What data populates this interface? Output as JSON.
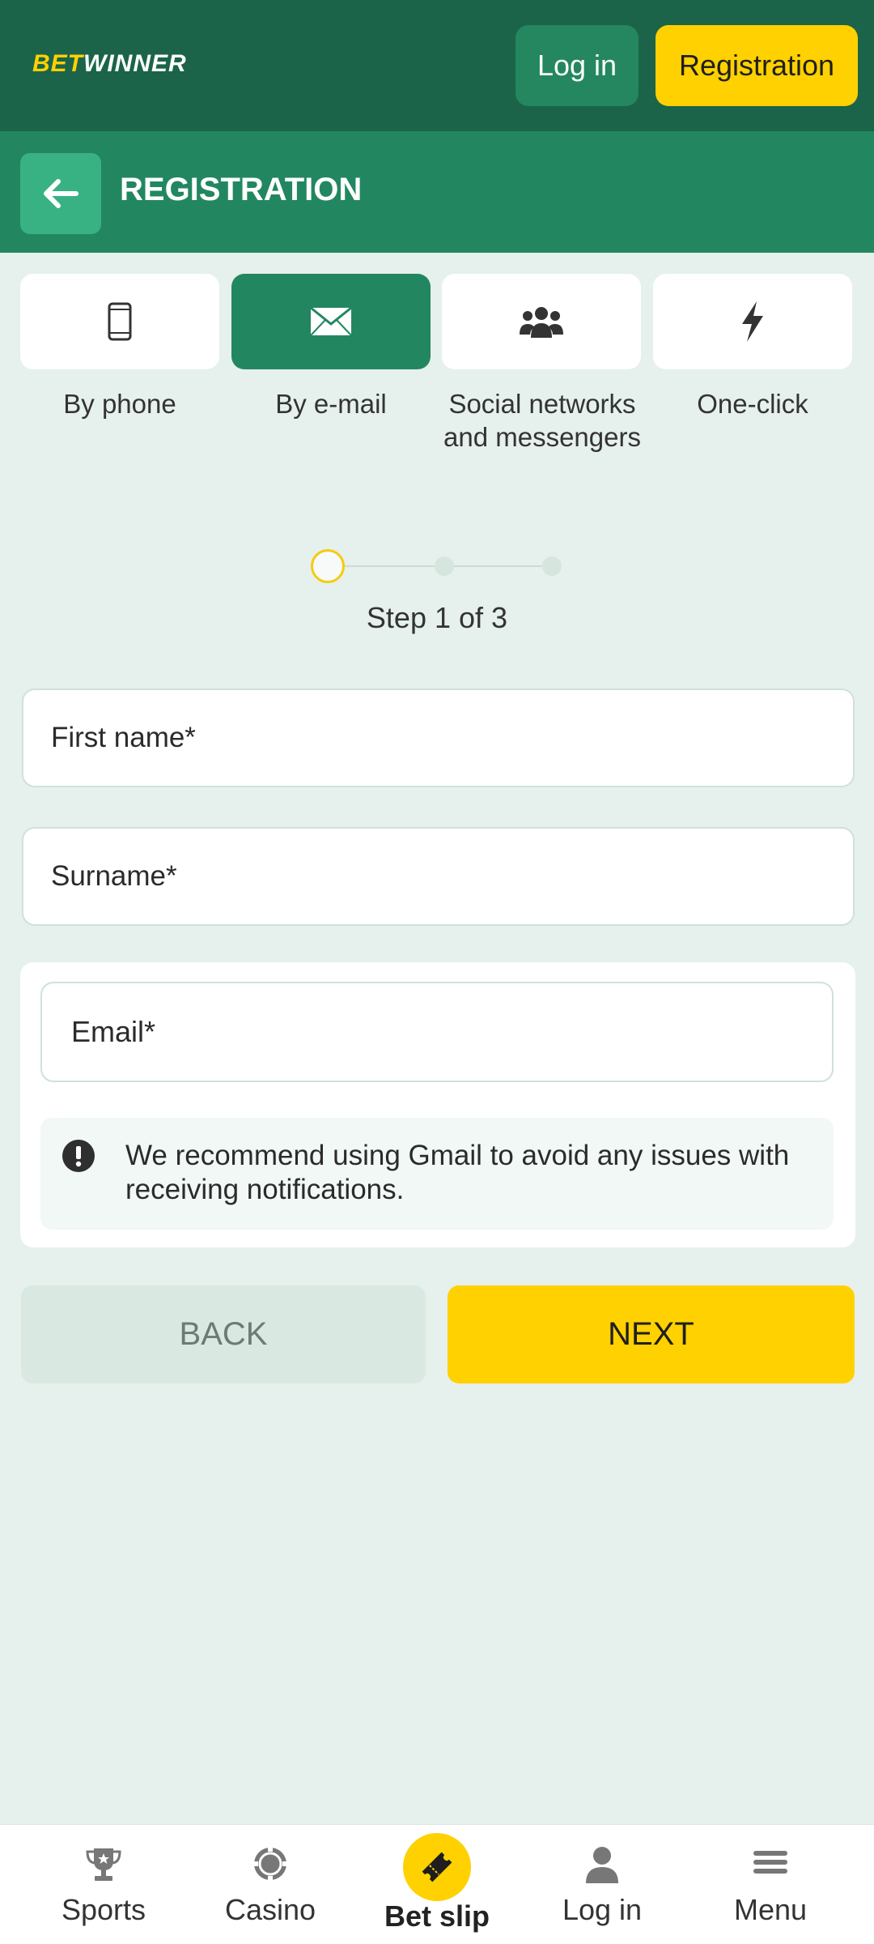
{
  "header": {
    "logo_bet": "BET",
    "logo_winner": "WINNER",
    "login_label": "Log in",
    "registration_label": "Registration"
  },
  "page": {
    "title": "REGISTRATION"
  },
  "methods": [
    {
      "label": "By phone",
      "icon": "phone-icon",
      "active": false
    },
    {
      "label": "By e-mail",
      "icon": "envelope-icon",
      "active": true
    },
    {
      "label": "Social networks and messengers",
      "icon": "users-icon",
      "active": false
    },
    {
      "label": "One-click",
      "icon": "lightning-icon",
      "active": false
    }
  ],
  "stepper": {
    "current": 1,
    "total": 3,
    "text": "Step 1 of 3"
  },
  "form": {
    "first_name_placeholder": "First name*",
    "surname_placeholder": "Surname*",
    "email_placeholder": "Email*",
    "notice": "We recommend using Gmail to avoid any issues with receiving notifications."
  },
  "actions": {
    "back_label": "BACK",
    "next_label": "NEXT"
  },
  "bottom_nav": [
    {
      "label": "Sports",
      "icon": "trophy-icon"
    },
    {
      "label": "Casino",
      "icon": "casino-chip-icon"
    },
    {
      "label": "Bet slip",
      "icon": "ticket-icon"
    },
    {
      "label": "Log in",
      "icon": "user-icon"
    },
    {
      "label": "Menu",
      "icon": "menu-icon"
    }
  ],
  "colors": {
    "brand_dark": "#1b6449",
    "brand_green": "#228760",
    "accent_yellow": "#ffd100",
    "background": "#e6f0ec"
  }
}
